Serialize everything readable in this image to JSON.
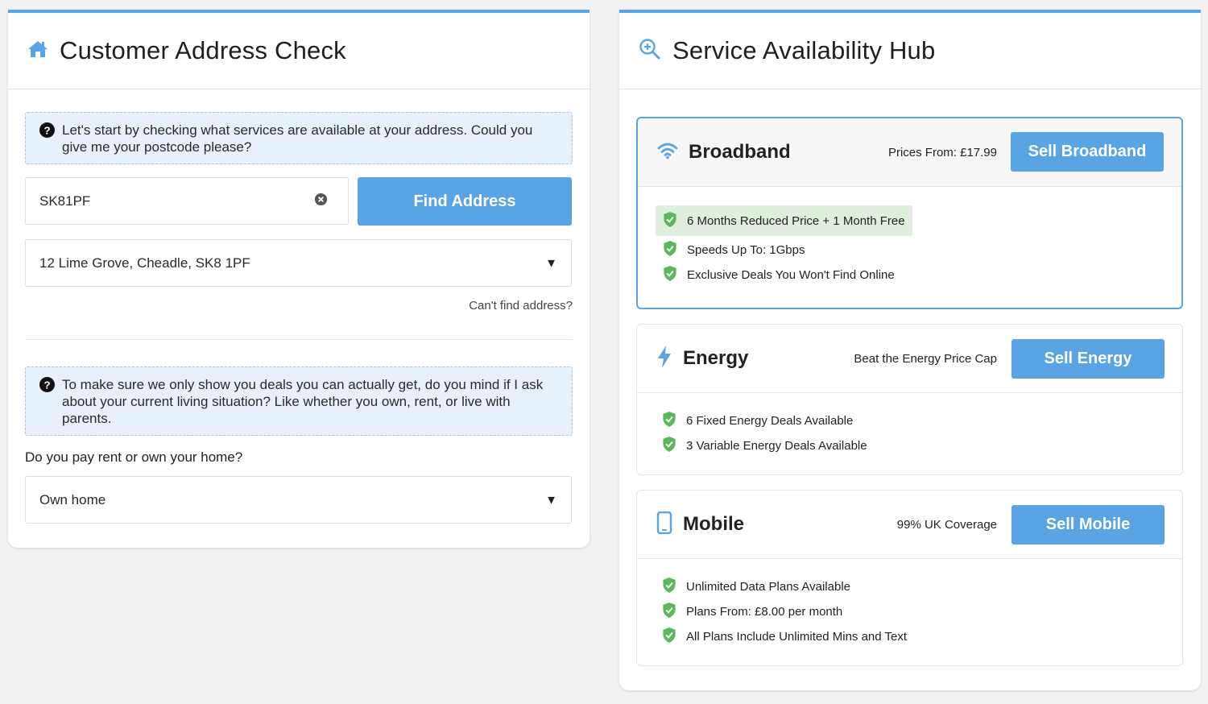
{
  "left": {
    "title": "Customer Address Check",
    "icon": "home-icon",
    "hint1": "Let's start by checking what services are available at your address. Could you give me your postcode please?",
    "postcode_value": "SK81PF",
    "find_button": "Find Address",
    "address_selected": "12 Lime Grove, Cheadle, SK8 1PF",
    "cant_find": "Can't find address?",
    "hint2": "To make sure we only show you deals you can actually get, do you mind if I ask about your current living situation? Like whether you own, rent, or live with parents.",
    "tenure_label": "Do you pay rent or own your home?",
    "tenure_selected": "Own home"
  },
  "right": {
    "title": "Service Availability Hub",
    "icon": "search-zoom-icon",
    "services": [
      {
        "name": "Broadband",
        "icon": "wifi-icon",
        "subtitle": "Prices From: £17.99",
        "button": "Sell Broadband",
        "features": [
          "6 Months Reduced Price + 1 Month Free",
          "Speeds Up To: 1Gbps",
          "Exclusive Deals You Won't Find Online"
        ]
      },
      {
        "name": "Energy",
        "icon": "lightning-icon",
        "subtitle": "Beat the Energy Price Cap",
        "button": "Sell Energy",
        "features": [
          "6 Fixed Energy Deals Available",
          "3 Variable Energy Deals Available"
        ]
      },
      {
        "name": "Mobile",
        "icon": "phone-icon",
        "subtitle": "99% UK Coverage",
        "button": "Sell Mobile",
        "features": [
          "Unlimited Data Plans Available",
          "Plans From: £8.00 per month",
          "All Plans Include Unlimited Mins and Text"
        ]
      }
    ]
  },
  "colors": {
    "accent": "#5aa4e3",
    "hint_bg": "#e6f1fc",
    "check_green": "#5cb85c",
    "highlight_bg": "#dfeedd"
  }
}
